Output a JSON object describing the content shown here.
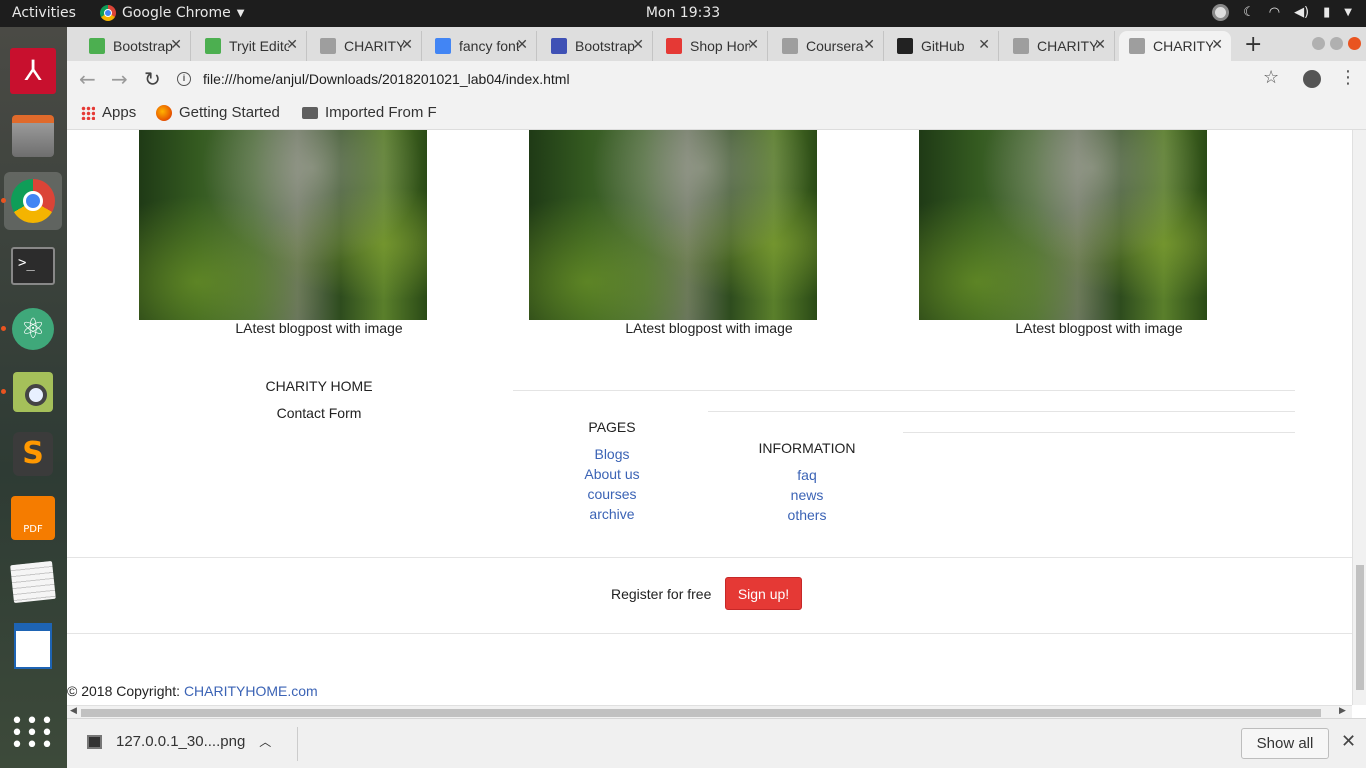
{
  "topbar": {
    "activities": "Activities",
    "app_name": "Google Chrome",
    "clock": "Mon 19:33"
  },
  "tabs": [
    {
      "title": "Bootstrap",
      "icon": "w3-icon",
      "color": "#4caf50"
    },
    {
      "title": "Tryit Editor",
      "icon": "w3-icon",
      "color": "#4caf50"
    },
    {
      "title": "CHARITY",
      "icon": "page-icon",
      "color": "#9e9e9e"
    },
    {
      "title": "fancy fonts",
      "icon": "google-icon",
      "color": "#4285f4"
    },
    {
      "title": "Bootstrap",
      "icon": "mdb-icon",
      "color": "#3f51b5"
    },
    {
      "title": "Shop Homepage",
      "icon": "s-icon",
      "color": "#e53935"
    },
    {
      "title": "Coursera",
      "icon": "cloud-icon",
      "color": "#9e9e9e"
    },
    {
      "title": "GitHub",
      "icon": "github-icon",
      "color": "#222222"
    },
    {
      "title": "CHARITY",
      "icon": "page-icon",
      "color": "#9e9e9e"
    },
    {
      "title": "CHARITY",
      "icon": "page-icon",
      "color": "#9e9e9e"
    }
  ],
  "toolbar": {
    "url": "file:///home/anjul/Downloads/2018201021_lab04/index.html"
  },
  "bookmarks": {
    "apps": "Apps",
    "getting_started": "Getting Started",
    "imported": "Imported From F"
  },
  "blog": {
    "captions": [
      "LAtest blogpost with image",
      "LAtest blogpost with image",
      "LAtest blogpost with image"
    ]
  },
  "footer": {
    "brand": "CHARITY HOME",
    "contact": "Contact Form",
    "pages_title": "PAGES",
    "pages_links": [
      "Blogs",
      "About us",
      "courses",
      "archive"
    ],
    "info_title": "INFORMATION",
    "info_links": [
      "faq",
      "news",
      "others"
    ],
    "register_text": "Register for free",
    "signup_label": "Sign up!",
    "copyright_prefix": "© 2018 Copyright: ",
    "copyright_link": "CHARITYHOME.com"
  },
  "shelf": {
    "file_name": "127.0.0.1_30....png",
    "show_all": "Show all"
  },
  "colors": {
    "link": "#3b63b5",
    "signup": "#e53935"
  }
}
